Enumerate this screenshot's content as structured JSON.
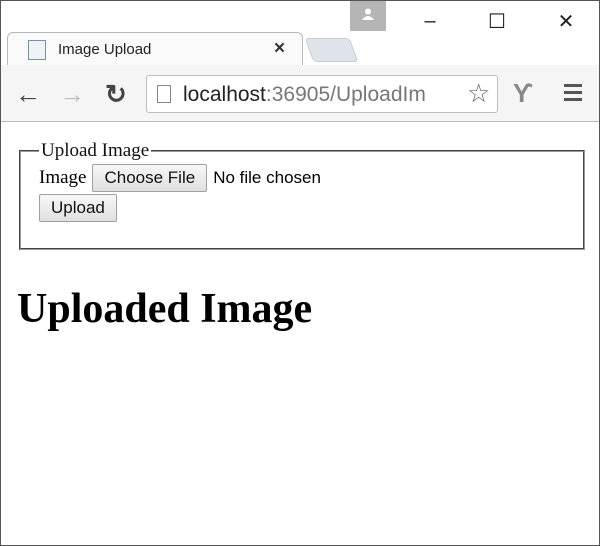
{
  "window": {
    "minimize": "–",
    "maximize": "☐",
    "close": "✕"
  },
  "tab": {
    "title": "Image Upload",
    "close": "×"
  },
  "toolbar": {
    "url_host": "localhost",
    "url_path": ":36905/UploadIm"
  },
  "form": {
    "legend": "Upload Image",
    "image_label": "Image",
    "choose_file": "Choose File",
    "file_status": "No file chosen",
    "upload": "Upload"
  },
  "heading": "Uploaded Image"
}
